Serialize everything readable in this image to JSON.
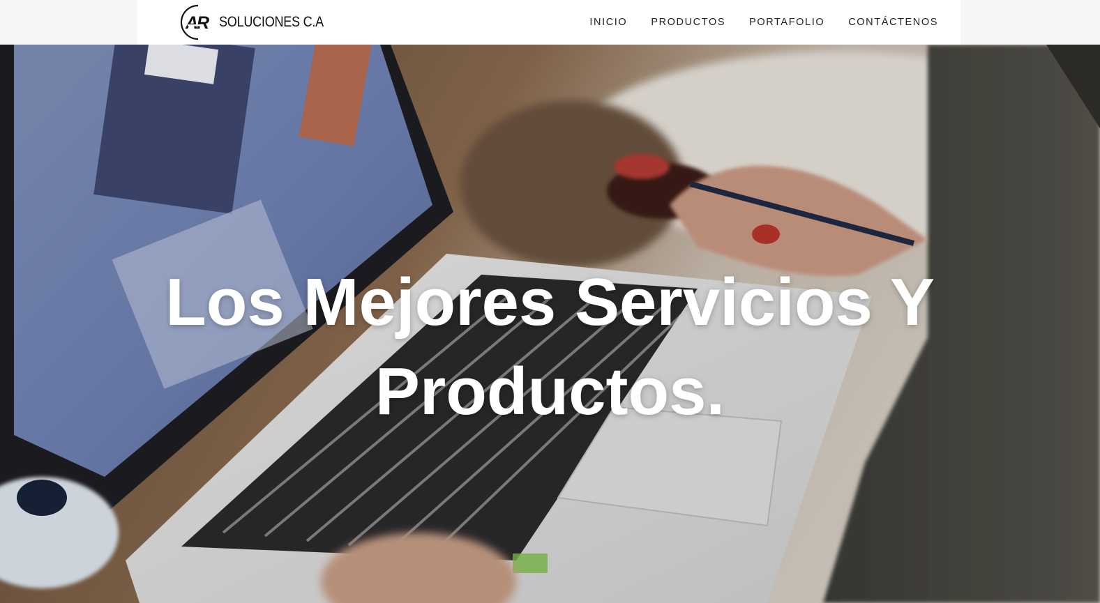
{
  "header": {
    "logo_mark": "AR",
    "logo_text": "SOLUCIONES C.A",
    "nav": [
      {
        "label": "INICIO"
      },
      {
        "label": "PRODUCTOS"
      },
      {
        "label": "PORTAFOLIO"
      },
      {
        "label": "CONTÁCTENOS"
      }
    ]
  },
  "hero": {
    "title": "Los Mejores Servicios Y Productos.",
    "background": "photo-laptop-typing"
  },
  "colors": {
    "nav_bg": "#ffffff",
    "hero_text": "#ffffff"
  }
}
